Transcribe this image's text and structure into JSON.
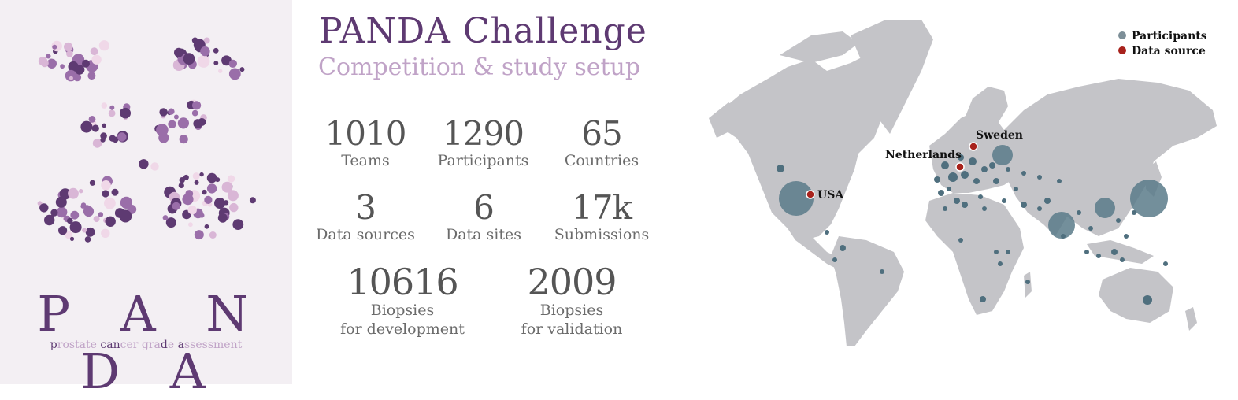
{
  "header": {
    "title": "PANDA Challenge",
    "subtitle": "Competition & study setup"
  },
  "logo": {
    "word": "P A N D A",
    "tagline": {
      "p": "p",
      "rostate": "rostate ",
      "c": "c",
      "a1": "a",
      "n": "n",
      "cer": "cer gra",
      "d": "d",
      "e": "e ",
      "a2": "a",
      "ssessment": "ssessment"
    },
    "colors": {
      "dark": "#5e3a72",
      "mid": "#9a6ea9",
      "light": "#d9b6d6",
      "pale": "#f0d8e8"
    }
  },
  "stats": [
    {
      "value": "1010",
      "label": "Teams"
    },
    {
      "value": "1290",
      "label": "Participants"
    },
    {
      "value": "65",
      "label": "Countries"
    },
    {
      "value": "3",
      "label": "Data sources"
    },
    {
      "value": "6",
      "label": "Data sites"
    },
    {
      "value": "17k",
      "label": "Submissions"
    },
    {
      "value": "10616",
      "label": "Biopsies",
      "label2": "for development"
    },
    {
      "value": "2009",
      "label": "Biopsies",
      "label2": "for validation"
    }
  ],
  "map": {
    "legend": [
      {
        "label": "Participants",
        "color": "#7d8f98"
      },
      {
        "label": "Data source",
        "color": "#a8221c"
      }
    ],
    "data_sources": [
      {
        "label": "USA"
      },
      {
        "label": "Netherlands"
      },
      {
        "label": "Sweden"
      }
    ]
  }
}
